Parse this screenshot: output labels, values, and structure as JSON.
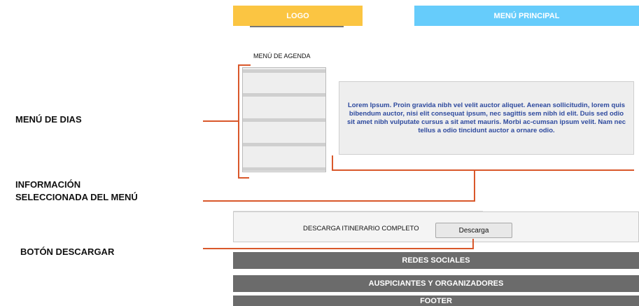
{
  "header": {
    "logo_label": "LOGO",
    "main_menu_label": "MENÚ PRINCIPAL"
  },
  "agenda": {
    "title": "MENÚ DE AGENDA"
  },
  "info_panel": {
    "text": "Lorem Ipsum. Proin gravida nibh vel velit auctor aliquet. Aenean sollicitudin, lorem quis bibendum auctor, nisi elit consequat ipsum, nec sagittis sem nibh id elit. Duis sed odio sit amet nibh vulputate cursus a sit amet mauris. Morbi ac-cumsan ipsum velit. Nam nec tellus a odio tincidunt auctor a ornare odio."
  },
  "download": {
    "label": "DESCARGA ITINERARIO COMPLETO",
    "button_label": "Descarga"
  },
  "bars": {
    "social": "REDES SOCIALES",
    "sponsors": "AUSPICIANTES Y ORGANIZADORES",
    "footer": "FOOTER"
  },
  "annotations": {
    "days_menu": "MENÚ  DE DIAS",
    "selected_info_line1": "INFORMACIÓN",
    "selected_info_line2": "SELECCIONADA DEL MENÚ",
    "download_button": "BOTÓN DESCARGAR"
  },
  "colors": {
    "logo": "#fbc542",
    "main_menu": "#66ccfb",
    "callout_line": "#d9582b",
    "info_text": "#2e4a9e",
    "grey_bar": "#6b6b6b"
  }
}
